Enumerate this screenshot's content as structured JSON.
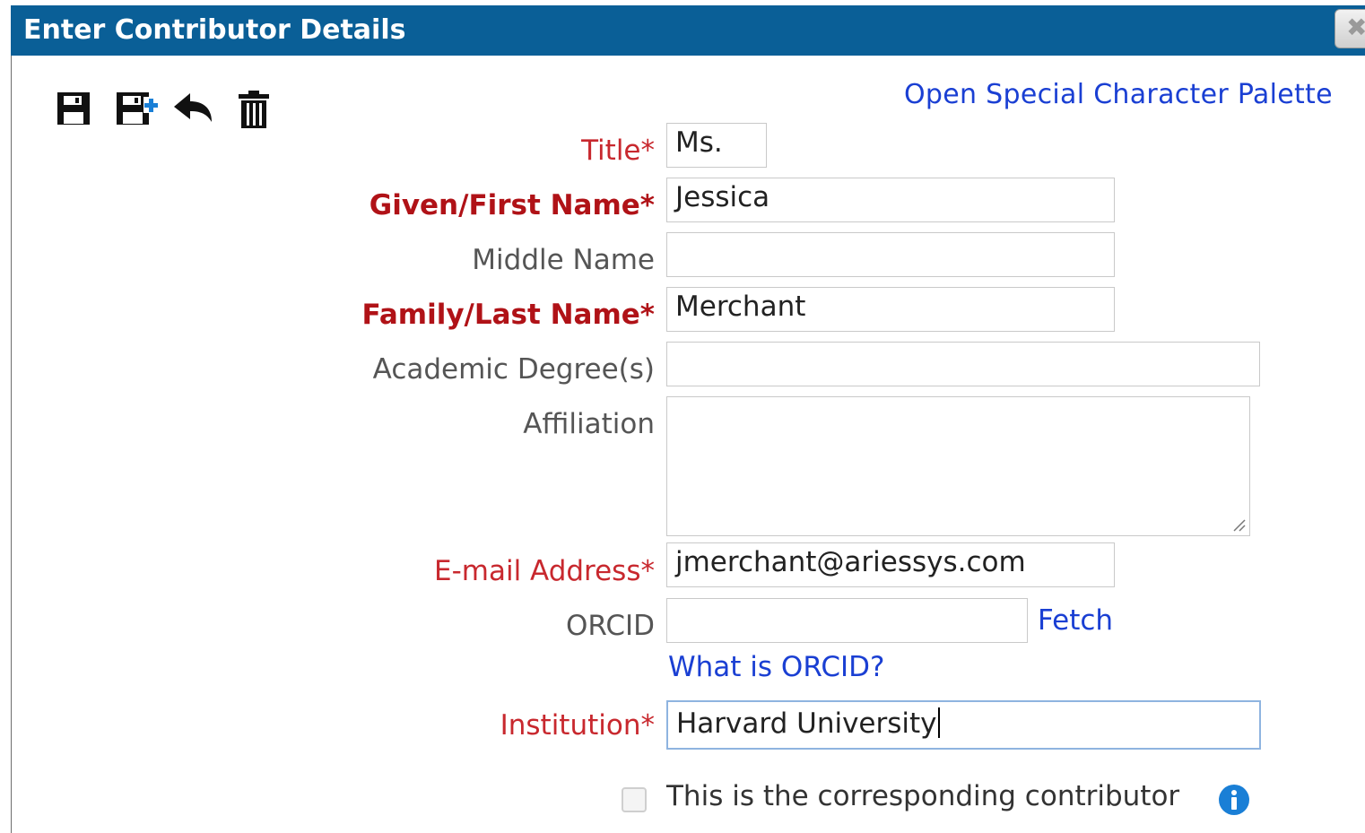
{
  "dialog": {
    "title": "Enter Contributor Details",
    "close_label": "✖"
  },
  "toolbar": {
    "icons": [
      "save-icon",
      "save-and-add-icon",
      "undo-icon",
      "trash-icon"
    ]
  },
  "palette_link": "Open Special Character Palette",
  "fields": {
    "title": {
      "label": "Title*",
      "value": "Ms."
    },
    "given_name": {
      "label": "Given/First Name*",
      "value": "Jessica"
    },
    "middle_name": {
      "label": "Middle Name",
      "value": ""
    },
    "family_name": {
      "label": "Family/Last Name*",
      "value": "Merchant"
    },
    "degrees": {
      "label": "Academic Degree(s)",
      "value": ""
    },
    "affiliation": {
      "label": "Affiliation",
      "value": ""
    },
    "email": {
      "label": "E-mail Address*",
      "value": "jmerchant@ariessys.com"
    },
    "orcid": {
      "label": "ORCID",
      "value": "",
      "fetch_label": "Fetch",
      "help_link": "What is ORCID?"
    },
    "institution": {
      "label": "Institution*",
      "value": "Harvard University"
    }
  },
  "corresponding": {
    "label": "This is the corresponding contributor",
    "checked": false
  },
  "colors": {
    "titlebar": "#0a5f97",
    "required_label": "#c8282e",
    "link": "#1a3fd3"
  }
}
